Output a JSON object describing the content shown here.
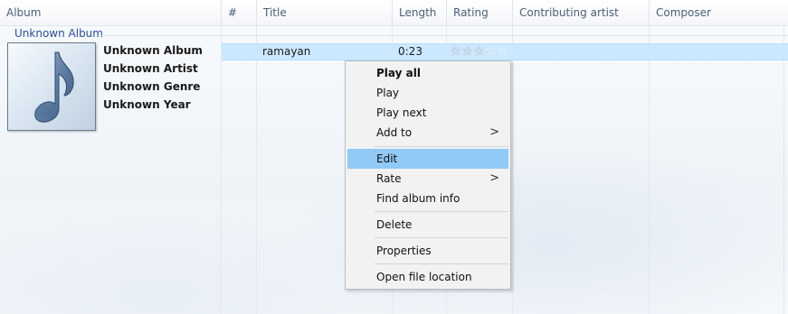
{
  "columns": [
    {
      "label": "Album"
    },
    {
      "label": "#"
    },
    {
      "label": "Title"
    },
    {
      "label": "Length"
    },
    {
      "label": "Rating"
    },
    {
      "label": "Contributing artist"
    },
    {
      "label": "Composer"
    }
  ],
  "group": {
    "title": "Unknown Album"
  },
  "album_info": [
    "Unknown Album",
    "Unknown Artist",
    "Unknown Genre",
    "Unknown Year"
  ],
  "album_art": {
    "icon": "music-note-icon"
  },
  "track": {
    "title": "ramayan",
    "length": "0:23",
    "rating_stars": 0,
    "max_stars": 5
  },
  "context_menu": {
    "items": [
      {
        "label": "Play all",
        "bold": true
      },
      {
        "label": "Play"
      },
      {
        "label": "Play next"
      },
      {
        "label": "Add to",
        "submenu": true
      },
      {
        "label": "Edit",
        "highlighted": true
      },
      {
        "label": "Rate",
        "submenu": true
      },
      {
        "label": "Find album info"
      },
      {
        "label": "Delete"
      },
      {
        "label": "Properties"
      },
      {
        "label": "Open file location"
      }
    ],
    "submenu_arrow": ">"
  },
  "colors": {
    "selection": "#cce8ff",
    "menu_highlight": "#91c9f7",
    "group_title": "#2b4d9a"
  }
}
